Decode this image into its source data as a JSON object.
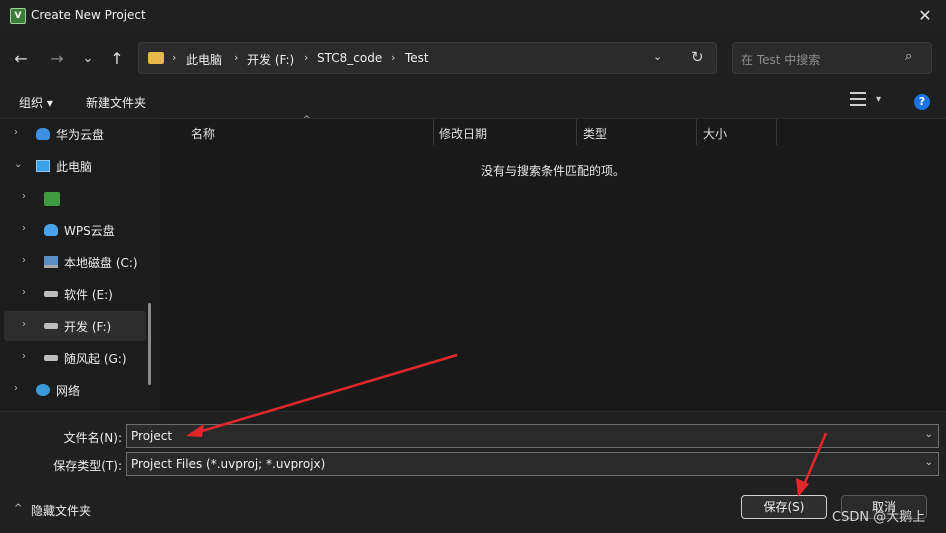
{
  "window": {
    "title": "Create New Project",
    "app_icon_glyph": "V",
    "close_glyph": "✕"
  },
  "nav": {
    "back_glyph": "←",
    "forward_glyph": "→",
    "recent_glyph": "⌄",
    "up_glyph": "↑",
    "breadcrumbs": [
      "此电脑",
      "开发 (F:)",
      "STC8_code",
      "Test"
    ],
    "crumb_separator": "›",
    "dropdown_glyph": "⌄",
    "refresh_glyph": "↻"
  },
  "search": {
    "placeholder": "在 Test 中搜索",
    "icon_glyph": "⌕"
  },
  "toolbar": {
    "organize_label": "组织 ▾",
    "new_folder_label": "新建文件夹",
    "view_dropdown_glyph": "▾",
    "help_glyph": "?"
  },
  "sidebar": {
    "items": [
      {
        "label": "华为云盘",
        "icon": "cloud-icon",
        "chevron": "›"
      },
      {
        "label": "此电脑",
        "icon": "monitor-icon",
        "chevron": "⌄"
      },
      {
        "label": "",
        "icon": "iqiyi-icon",
        "chevron": "›"
      },
      {
        "label": "WPS云盘",
        "icon": "cloud-icon",
        "chevron": "›"
      },
      {
        "label": "本地磁盘 (C:)",
        "icon": "windows-drive-icon",
        "chevron": "›"
      },
      {
        "label": "软件 (E:)",
        "icon": "drive-icon",
        "chevron": "›"
      },
      {
        "label": "开发 (F:)",
        "icon": "drive-icon",
        "chevron": "›"
      },
      {
        "label": "随风起 (G:)",
        "icon": "drive-icon",
        "chevron": "›"
      },
      {
        "label": "网络",
        "icon": "network-icon",
        "chevron": "›"
      }
    ],
    "selected_index": 6
  },
  "content": {
    "columns": [
      "名称",
      "修改日期",
      "类型",
      "大小"
    ],
    "sort_glyph": "^",
    "empty_message": "没有与搜索条件匹配的项。"
  },
  "form": {
    "filename_label": "文件名(N):",
    "filename_value": "Project",
    "filetype_label": "保存类型(T):",
    "filetype_value": "Project Files (*.uvproj; *.uvprojx)",
    "dropdown_glyph": "⌄"
  },
  "footer": {
    "hide_folders_label": "隐藏文件夹",
    "hide_chevron_glyph": "^",
    "save_label": "保存(S)",
    "cancel_label": "取消"
  },
  "watermark": "CSDN @大鹅上",
  "colors": {
    "annotation_arrow": "#e3262a",
    "accent": "#1a73e8",
    "folder": "#e8b84a"
  }
}
